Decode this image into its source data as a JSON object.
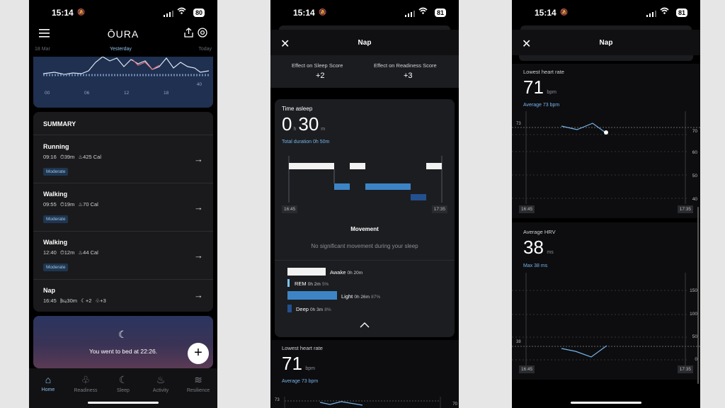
{
  "status": {
    "time": "15:14",
    "battery1": "80",
    "battery2": "81",
    "battery3": "81"
  },
  "home": {
    "brand": "ŌURA",
    "dates": {
      "left": "18 Mar",
      "center": "Yesterday",
      "right": "Today"
    },
    "chart_ticks": [
      "00",
      "06",
      "12",
      "18"
    ],
    "chart_right": "40",
    "summary_title": "SUMMARY",
    "activities": [
      {
        "name": "Running",
        "time": "09:16",
        "duration": "39m",
        "cal": "425 Cal",
        "badge": "Moderate"
      },
      {
        "name": "Walking",
        "time": "09:55",
        "duration": "19m",
        "cal": "70 Cal",
        "badge": "Moderate"
      },
      {
        "name": "Walking",
        "time": "12:40",
        "duration": "12m",
        "cal": "44 Cal",
        "badge": "Moderate"
      },
      {
        "name": "Nap",
        "time": "16:45",
        "duration": "30m",
        "sleep": "+2",
        "readiness": "+3"
      }
    ],
    "bed_text": "You went to bed at 22:26.",
    "nav": [
      "Home",
      "Readiness",
      "Sleep",
      "Activity",
      "Resilience"
    ]
  },
  "nap": {
    "title": "Nap",
    "effect_sleep_label": "Effect on Sleep Score",
    "effect_sleep_value": "+2",
    "effect_readiness_label": "Effect on Readiness Score",
    "effect_readiness_value": "+3",
    "time_asleep_label": "Time asleep",
    "time_h": "0",
    "time_h_unit": "h",
    "time_m": "30",
    "time_m_unit": "m",
    "total_duration": "Total duration 0h 50m",
    "start": "16:45",
    "end": "17:35",
    "movement_title": "Movement",
    "movement_text": "No significant movement during your sleep",
    "legend": [
      {
        "name": "Awake",
        "value": "0h 20m",
        "pct": "",
        "color": "#f2f2f2"
      },
      {
        "name": "REM",
        "value": "0h 2m",
        "pct": "5%",
        "color": "#7cc3f5"
      },
      {
        "name": "Light",
        "value": "0h 26m",
        "pct": "87%",
        "color": "#3d84c6"
      },
      {
        "name": "Deep",
        "value": "0h 3m",
        "pct": "8%",
        "color": "#24508e"
      }
    ],
    "lowest_hr_label": "Lowest heart rate",
    "lowest_hr_value": "71",
    "lowest_hr_unit": "bpm",
    "avg_hr": "Average 73 bpm",
    "hr_axis_left": "73",
    "hr_axis_right": "70"
  },
  "hr": {
    "title": "Nap",
    "lowest_hr_label": "Lowest heart rate",
    "lowest_hr_value": "71",
    "lowest_hr_unit": "bpm",
    "avg_hr": "Average 73 bpm",
    "hr_ref": "73",
    "hr_axis": [
      "70",
      "60",
      "50",
      "40"
    ],
    "start": "16:45",
    "end": "17:35",
    "hrv_label": "Average HRV",
    "hrv_value": "38",
    "hrv_unit": "ms",
    "hrv_max": "Max 38 ms",
    "hrv_ref": "38",
    "hrv_axis": [
      "150",
      "100",
      "50",
      "0"
    ]
  }
}
